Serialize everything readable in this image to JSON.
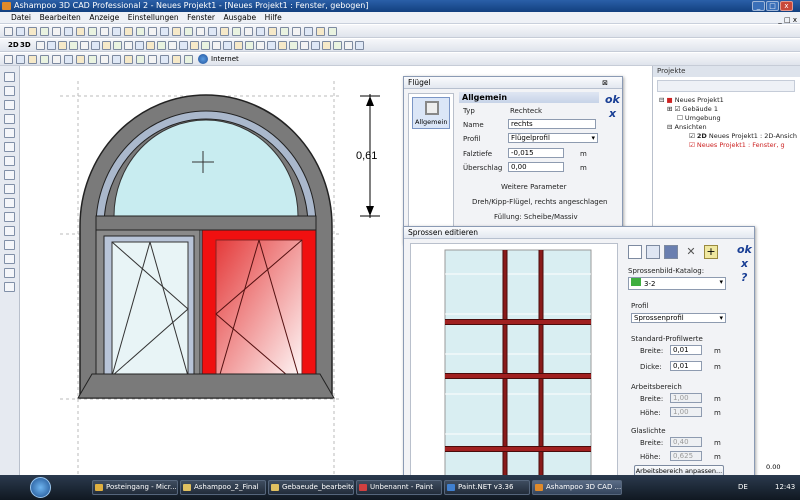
{
  "window": {
    "title": "Ashampoo 3D CAD Professional 2 - Neues Projekt1 - [Neues Projekt1 : Fenster, gebogen]"
  },
  "menu": [
    "Datei",
    "Bearbeiten",
    "Anzeige",
    "Einstellungen",
    "Fenster",
    "Ausgabe",
    "Hilfe"
  ],
  "toolbar": {
    "internet_label": "Internet",
    "view_2d": "2D",
    "view_3d": "3D"
  },
  "drawing": {
    "dimension_label": "0,61"
  },
  "project_panel": {
    "title": "Projekte",
    "items": [
      "Neues Projekt1",
      "Gebäude 1",
      "Umgebung",
      "Ansichten",
      "Neues Projekt1 : 2D-Ansich",
      "Neues Projekt1 : Fenster, g"
    ],
    "view_2d": "2D"
  },
  "fluegel_dialog": {
    "title": "Flügel",
    "tab": "Allgemein",
    "section": "Allgemein",
    "typ_label": "Typ",
    "typ_value": "Rechteck",
    "name_label": "Name",
    "name_value": "rechts",
    "profil_label": "Profil",
    "profil_value": "Flügelprofil",
    "falztiefe_label": "Falztiefe",
    "falztiefe_value": "-0,015",
    "ueberschlag_label": "Überschlag",
    "ueberschlag_value": "0,00",
    "unit": "m",
    "weitere": "Weitere Parameter",
    "dreh": "Dreh/Kipp-Flügel, rechts angeschlagen",
    "fuellung": "Füllung: Scheibe/Massiv",
    "ok": "ok",
    "x": "x"
  },
  "sprossen_dialog": {
    "title": "Sprossen editieren",
    "katalog_label": "Sprossenbild-Katalog:",
    "katalog_value": "3-2",
    "profil_section": "Profil",
    "profil_value": "Sprossenprofil",
    "standard_section": "Standard-Profilwerte",
    "breite_label": "Breite:",
    "breite_value": "0,01",
    "dicke_label": "Dicke:",
    "dicke_value": "0,01",
    "arbeits_section": "Arbeitsbereich",
    "ab_breite_value": "1,00",
    "ab_hoehe_label": "Höhe:",
    "ab_hoehe_value": "1,00",
    "glas_section": "Glaslichte",
    "gl_breite_value": "0,40",
    "gl_hoehe_value": "0,625",
    "anpassen_button": "Arbeitsbereich anpassen...",
    "unit": "m",
    "ok": "ok",
    "x": "x",
    "help": "?"
  },
  "statusbar": {
    "value": "0.00"
  },
  "taskbar": {
    "items": [
      "Posteingang - Micr...",
      "Ashampoo_2_Final",
      "Gebaeude_bearbeite...",
      "Unbenannt - Paint",
      "Paint.NET v3.36",
      "Ashampoo 3D CAD ..."
    ],
    "lang": "DE",
    "clock": "12:43"
  }
}
